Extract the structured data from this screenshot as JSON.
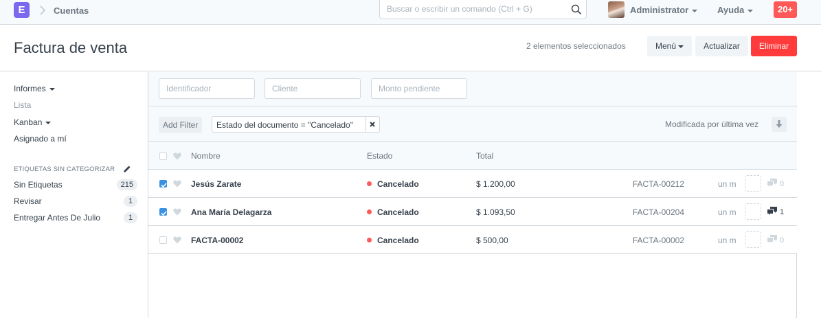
{
  "navbar": {
    "logo_letter": "E",
    "breadcrumb": "Cuentas",
    "search_placeholder": "Buscar o escribir un comando (Ctrl + G)",
    "user_name": "Administrator",
    "help_label": "Ayuda",
    "notifications": "20+"
  },
  "page_head": {
    "title": "Factura de venta",
    "selected_count": "2 elementos seleccionados",
    "menu_label": "Menú",
    "refresh_label": "Actualizar",
    "delete_label": "Eliminar"
  },
  "sidebar": {
    "reports": "Informes",
    "list": "Lista",
    "kanban": "Kanban",
    "assigned": "Asignado a mí",
    "tags_heading": "ETIQUETAS SIN CATEGORIZAR",
    "tags": [
      {
        "label": "Sin Etiquetas",
        "count": "215"
      },
      {
        "label": "Revisar",
        "count": "1"
      },
      {
        "label": "Entregar Antes De Julio",
        "count": "1"
      }
    ]
  },
  "filters": {
    "id_placeholder": "Identificador",
    "customer_placeholder": "Cliente",
    "outstanding_placeholder": "Monto pendiente",
    "add_filter": "Add Filter",
    "active_filter": "Estado del documento = \"Cancelado\"",
    "sort_label": "Modificada por última vez"
  },
  "list": {
    "columns": {
      "name": "Nombre",
      "status": "Estado",
      "total": "Total"
    },
    "rows": [
      {
        "checked": true,
        "name": "Jesús Zarate",
        "status": "Cancelado",
        "total": "$ 1.200,00",
        "id": "FACTA-00212",
        "modified": "un m",
        "comments": "0"
      },
      {
        "checked": true,
        "name": "Ana María Delagarza",
        "status": "Cancelado",
        "total": "$ 1.093,50",
        "id": "FACTA-00204",
        "modified": "un m",
        "comments": "1"
      },
      {
        "checked": false,
        "name": "FACTA-00002",
        "status": "Cancelado",
        "total": "$ 500,00",
        "id": "FACTA-00002",
        "modified": "un m",
        "comments": "0"
      }
    ]
  },
  "colors": {
    "accent": "#7b68ee",
    "danger": "#ff3b3b",
    "notif": "#ff5858",
    "checkbox": "#3b92e4",
    "status_cancelled": "#ff5858"
  }
}
